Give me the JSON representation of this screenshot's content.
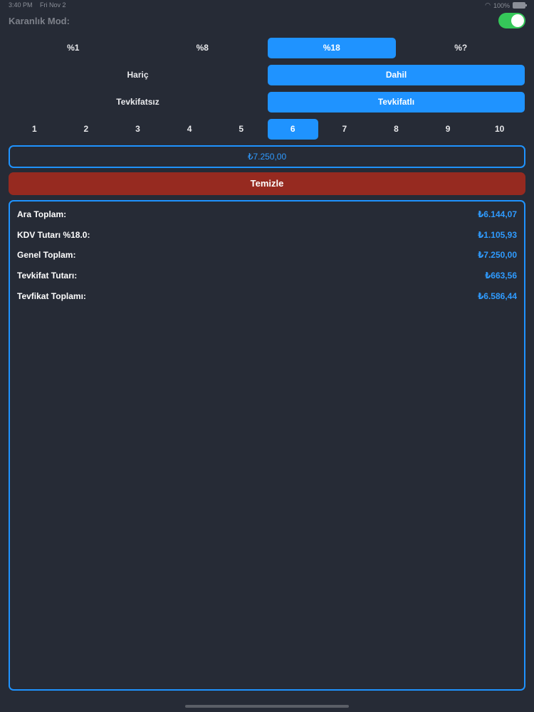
{
  "status_bar": {
    "time": "3:40 PM",
    "date": "Fri Nov 2",
    "battery": "100%",
    "wifi_icon": "wifi-icon",
    "battery_icon": "battery-icon"
  },
  "dark_mode": {
    "label": "Karanlık Mod:",
    "enabled": true,
    "toggle_color": "#35c759"
  },
  "vat_rates": {
    "options": [
      "%1",
      "%8",
      "%18",
      "%?"
    ],
    "selected_index": 2
  },
  "inclusion": {
    "options": [
      "Hariç",
      "Dahil"
    ],
    "selected_index": 1
  },
  "withholding": {
    "options": [
      "Tevkifatsız",
      "Tevkifatlı"
    ],
    "selected_index": 1
  },
  "withholding_ratio": {
    "options": [
      "1",
      "2",
      "3",
      "4",
      "5",
      "6",
      "7",
      "8",
      "9",
      "10"
    ],
    "selected_index": 5
  },
  "amount_input": {
    "value": "₺7.250,00"
  },
  "clear_button": {
    "label": "Temizle",
    "color": "#962a20"
  },
  "results": [
    {
      "label": "Ara Toplam:",
      "value": "₺6.144,07"
    },
    {
      "label": "KDV Tutarı %18.0:",
      "value": "₺1.105,93"
    },
    {
      "label": "Genel Toplam:",
      "value": "₺7.250,00"
    },
    {
      "label": "Tevkifat Tutarı:",
      "value": "₺663,56"
    },
    {
      "label": "Tevfikat Toplamı:",
      "value": "₺6.586,44"
    }
  ],
  "colors": {
    "accent": "#1f93ff",
    "background": "#262b36"
  }
}
